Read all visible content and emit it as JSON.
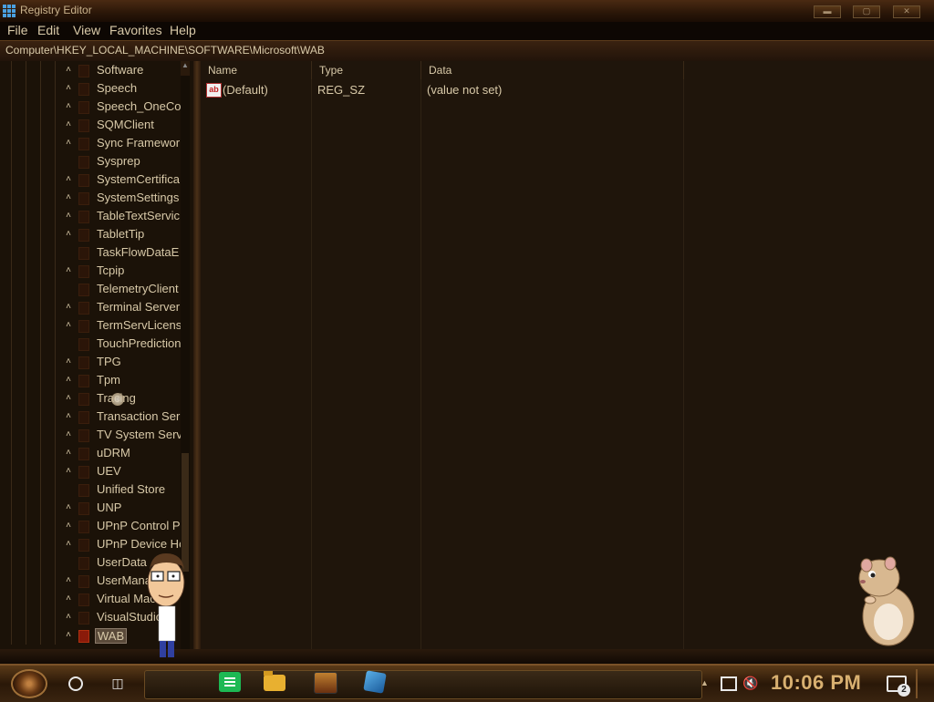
{
  "window": {
    "title": "Registry Editor",
    "controls": [
      "minimize",
      "maximize",
      "close"
    ]
  },
  "menu": [
    "File",
    "Edit",
    "View",
    "Favorites",
    "Help"
  ],
  "address": "Computer\\HKEY_LOCAL_MACHINE\\SOFTWARE\\Microsoft\\WAB",
  "tree": {
    "items": [
      {
        "label": "Software",
        "expandable": true
      },
      {
        "label": "Speech",
        "expandable": true
      },
      {
        "label": "Speech_OneCo",
        "expandable": true
      },
      {
        "label": "SQMClient",
        "expandable": true
      },
      {
        "label": "Sync Framewor",
        "expandable": true
      },
      {
        "label": "Sysprep",
        "expandable": false
      },
      {
        "label": "SystemCertifica",
        "expandable": true
      },
      {
        "label": "SystemSettings",
        "expandable": true
      },
      {
        "label": "TableTextServic",
        "expandable": true
      },
      {
        "label": "TabletTip",
        "expandable": true
      },
      {
        "label": "TaskFlowDataE",
        "expandable": false
      },
      {
        "label": "Tcpip",
        "expandable": true
      },
      {
        "label": "TelemetryClient",
        "expandable": false
      },
      {
        "label": "Terminal Server",
        "expandable": true
      },
      {
        "label": "TermServLicens",
        "expandable": true
      },
      {
        "label": "TouchPrediction",
        "expandable": false
      },
      {
        "label": "TPG",
        "expandable": true
      },
      {
        "label": "Tpm",
        "expandable": true
      },
      {
        "label": "Tracing",
        "expandable": true
      },
      {
        "label": "Transaction Ser",
        "expandable": true
      },
      {
        "label": "TV System Serv",
        "expandable": true
      },
      {
        "label": "uDRM",
        "expandable": true
      },
      {
        "label": "UEV",
        "expandable": true
      },
      {
        "label": "Unified Store",
        "expandable": false
      },
      {
        "label": "UNP",
        "expandable": true
      },
      {
        "label": "UPnP Control P",
        "expandable": true
      },
      {
        "label": "UPnP Device Ho",
        "expandable": true
      },
      {
        "label": "UserData",
        "expandable": false
      },
      {
        "label": "UserManager",
        "expandable": true
      },
      {
        "label": "Virtual Machine",
        "expandable": true
      },
      {
        "label": "VisualStudio",
        "expandable": true
      },
      {
        "label": "WAB",
        "expandable": true,
        "selected": true
      }
    ]
  },
  "list": {
    "columns": [
      "Name",
      "Type",
      "Data"
    ],
    "rows": [
      {
        "icon": "ab",
        "name": "(Default)",
        "type": "REG_SZ",
        "data": "(value not set)"
      }
    ]
  },
  "taskbar": {
    "clock": "10:06 PM",
    "notifications": "2",
    "apps": [
      "notes-app",
      "file-explorer",
      "game-app",
      "registry-editor"
    ]
  },
  "colors": {
    "accent": "#d8b070",
    "background": "#1f150b",
    "text": "#d8c9a8"
  }
}
